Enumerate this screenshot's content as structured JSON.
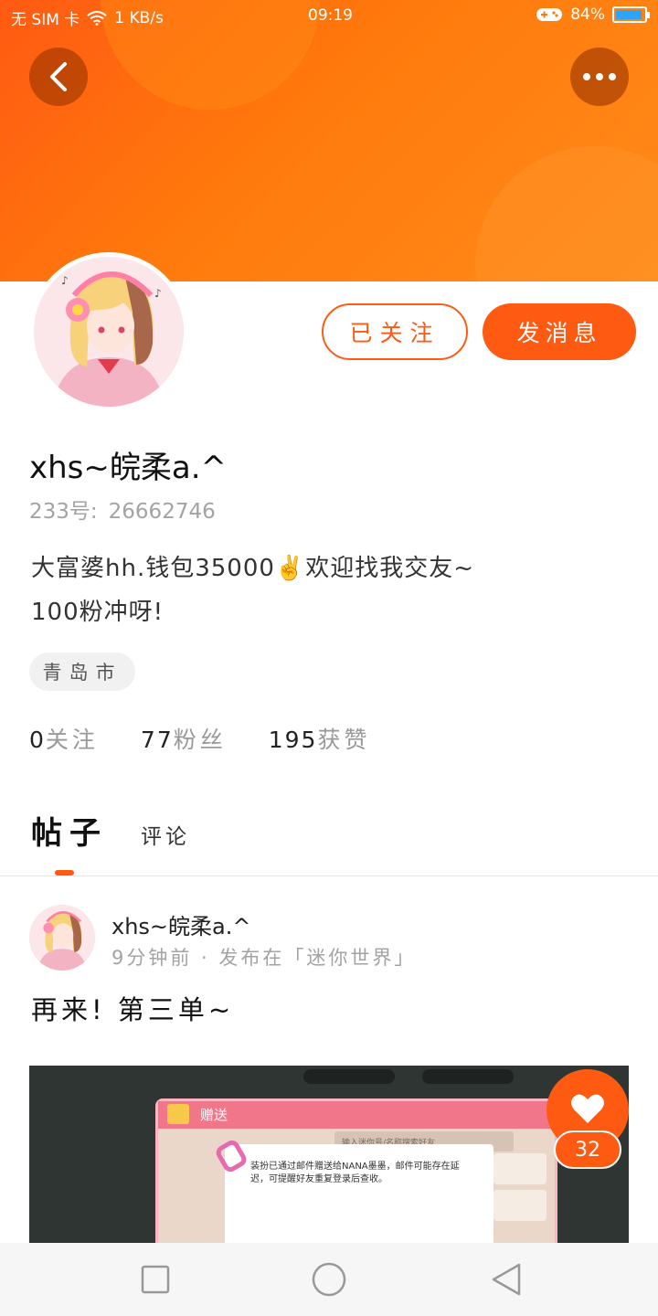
{
  "status_bar": {
    "carrier": "无 SIM 卡",
    "speed": "1 KB/s",
    "time": "09:19",
    "battery": "84%",
    "battery_level": 0.84
  },
  "profile": {
    "followed_label": "已关注",
    "message_label": "发消息",
    "username": "xhs~皖柔a.^",
    "uid_label": "233号:",
    "uid_value": "26662746",
    "bio_line1": "大富婆hh.钱包35000✌️欢迎找我交友~",
    "bio_line2": "100粉冲呀!",
    "location": "青岛市",
    "stats": [
      {
        "value": "0",
        "label": "关注"
      },
      {
        "value": "77",
        "label": "粉丝"
      },
      {
        "value": "195",
        "label": "获赞"
      }
    ]
  },
  "tabs": {
    "posts": "帖子",
    "comments": "评论"
  },
  "post": {
    "author": "xhs~皖柔a.^",
    "meta": "9分钟前 · 发布在「迷你世界」",
    "text": "再来! 第三单~",
    "image": {
      "panel_title": "赠送",
      "search_placeholder": "输入迷你号/名称搜索好友",
      "message": "装扮已通过邮件赠送给NANA墨墨，邮件可能存在延迟，可提醒好友重复登录后查收。"
    },
    "likes": "32"
  },
  "colors": {
    "accent": "#ff5a12",
    "header_gradient_end": "#ff8b1a"
  }
}
